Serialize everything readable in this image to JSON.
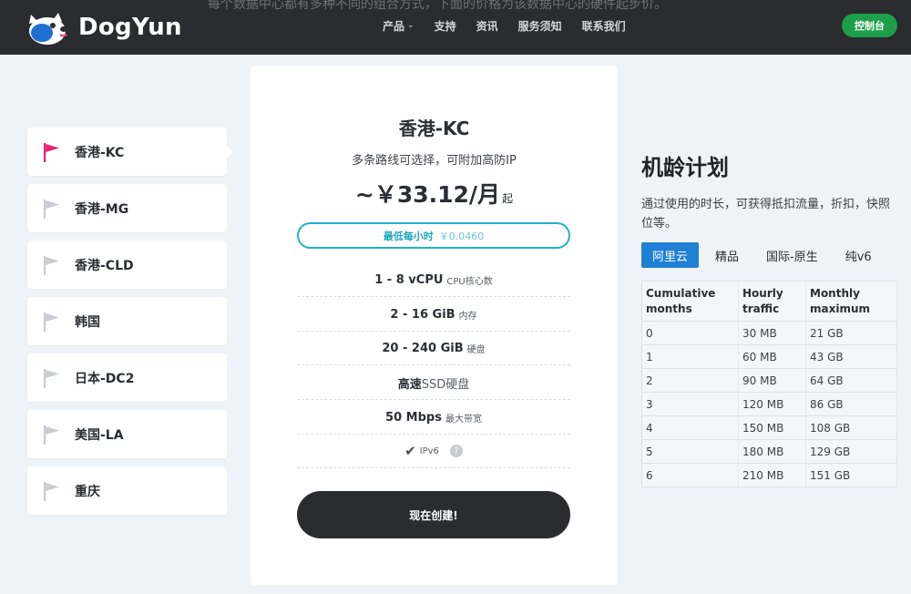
{
  "header": {
    "background_text": "每个数据中心都有多种不同的组合方式，下面的价格为该数据中心的硬件起步价。",
    "brand": "DogYun",
    "nav": [
      {
        "label": "产品",
        "has_dropdown": true
      },
      {
        "label": "支持"
      },
      {
        "label": "资讯"
      },
      {
        "label": "服务须知"
      },
      {
        "label": "联系我们"
      }
    ],
    "console_label": "控制台"
  },
  "sidebar": {
    "active_index": 0,
    "items": [
      {
        "label": "香港-KC"
      },
      {
        "label": "香港-MG"
      },
      {
        "label": "香港-CLD"
      },
      {
        "label": "韩国"
      },
      {
        "label": "日本-DC2"
      },
      {
        "label": "美国-LA"
      },
      {
        "label": "重庆"
      }
    ]
  },
  "card": {
    "title": "香港-KC",
    "subtitle": "多条路线可选择，可附加高防IP",
    "price": "~￥33.12/月",
    "price_suffix": "起",
    "hourly_label": "最低每小时",
    "hourly_value": "￥0.0460",
    "specs": [
      {
        "main": "1 - 8 vCPU",
        "sub": "CPU核心数"
      },
      {
        "main": "2 - 16 GiB",
        "sub": "内存"
      },
      {
        "main": "20 - 240 GiB",
        "sub": "硬盘"
      },
      {
        "main": "高速",
        "ssd": "SSD硬盘"
      },
      {
        "main": "50 Mbps",
        "sub": "最大带宽"
      }
    ],
    "ipv6_label": "IPv6",
    "help_glyph": "?",
    "create_label": "现在创建!"
  },
  "plan": {
    "title": "机龄计划",
    "description": "通过使用的时长，可获得抵扣流量，折扣，快照位等。",
    "tabs": [
      "阿里云",
      "精品",
      "国际-原生",
      "纯v6"
    ],
    "active_tab": 0,
    "columns": [
      "Cumulative months",
      "Hourly traffic",
      "Monthly maximum"
    ],
    "rows": [
      [
        "0",
        "30 MB",
        "21 GB"
      ],
      [
        "1",
        "60 MB",
        "43 GB"
      ],
      [
        "2",
        "90 MB",
        "64 GB"
      ],
      [
        "3",
        "120 MB",
        "86 GB"
      ],
      [
        "4",
        "150 MB",
        "108 GB"
      ],
      [
        "5",
        "180 MB",
        "129 GB"
      ],
      [
        "6",
        "210 MB",
        "151 GB"
      ]
    ]
  },
  "colors": {
    "header_bg": "#2a2c2f",
    "console_green": "#1e9e48",
    "active_flag": "#e8236f",
    "inactive_flag": "#c9ccd0",
    "hourly_border": "#1fb2c8",
    "tab_active": "#1f7fd4"
  },
  "icons": {
    "logo": "dog-logo-icon",
    "flag": "flag-icon",
    "check": "check-icon",
    "help": "help-circle-icon",
    "chevron": "chevron-down-icon"
  }
}
